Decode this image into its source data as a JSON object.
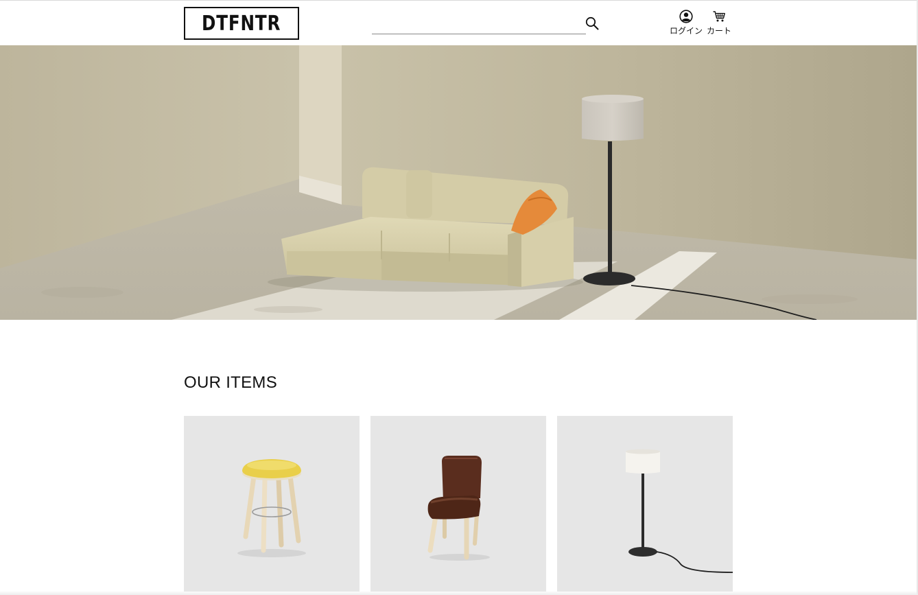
{
  "header": {
    "logo_text": "DTFNTR",
    "search": {
      "value": "",
      "placeholder": ""
    },
    "nav": {
      "login_label": "ログイン",
      "cart_label": "カート"
    }
  },
  "hero": {
    "image": "living-room-sofa-with-floor-lamp"
  },
  "items_section": {
    "title": "OUR ITEMS",
    "items": [
      {
        "image": "yellow-cushion-wooden-stool"
      },
      {
        "image": "brown-leather-wooden-chair"
      },
      {
        "image": "black-floor-lamp-white-shade"
      }
    ]
  },
  "colors": {
    "background": "#ffffff",
    "text": "#111111",
    "card_bg": "#e6e6e6",
    "wall": "#c9c2ab",
    "sofa": "#d9d2ae",
    "pillow": "#e58a3a"
  },
  "icons": [
    "armchair-logo-icon",
    "search-icon",
    "user-icon",
    "cart-icon"
  ]
}
